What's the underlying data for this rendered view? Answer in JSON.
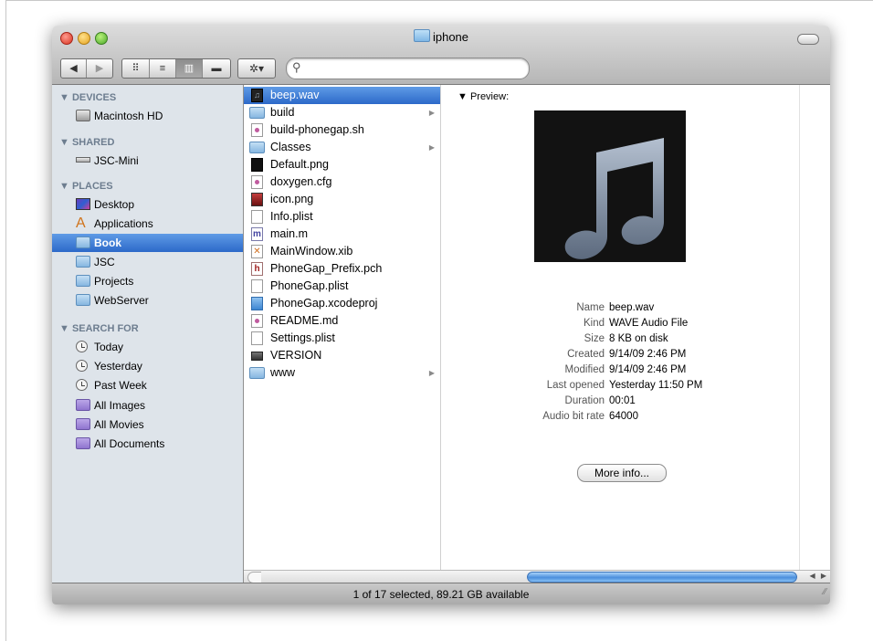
{
  "window": {
    "title": "iphone"
  },
  "toolbar": {
    "back_glyph": "◀",
    "forward_glyph": "▶",
    "views": [
      "⠿",
      "≡",
      "▥",
      "▬"
    ],
    "action_glyph": "✲▾",
    "search": {
      "placeholder": "",
      "value": ""
    }
  },
  "sidebar": {
    "sections": [
      {
        "label": "▼ DEVICES",
        "items": [
          {
            "label": "Macintosh HD",
            "icon": "hard-drive-icon"
          }
        ]
      },
      {
        "label": "▼ SHARED",
        "items": [
          {
            "label": "JSC-Mini",
            "icon": "mac-mini-icon"
          }
        ]
      },
      {
        "label": "▼ PLACES",
        "items": [
          {
            "label": "Desktop",
            "icon": "desktop-icon"
          },
          {
            "label": "Applications",
            "icon": "applications-icon"
          },
          {
            "label": "Book",
            "icon": "folder-icon",
            "selected": true
          },
          {
            "label": "JSC",
            "icon": "folder-icon"
          },
          {
            "label": "Projects",
            "icon": "folder-icon"
          },
          {
            "label": "WebServer",
            "icon": "folder-icon"
          }
        ]
      },
      {
        "label": "▼ SEARCH FOR",
        "items": [
          {
            "label": "Today",
            "icon": "clock-icon"
          },
          {
            "label": "Yesterday",
            "icon": "clock-icon"
          },
          {
            "label": "Past Week",
            "icon": "clock-icon"
          },
          {
            "label": "All Images",
            "icon": "smart-folder-icon"
          },
          {
            "label": "All Movies",
            "icon": "smart-folder-icon"
          },
          {
            "label": "All Documents",
            "icon": "smart-folder-icon"
          }
        ]
      }
    ]
  },
  "files": [
    {
      "name": "beep.wav",
      "icon": "audio-file-icon",
      "selected": true
    },
    {
      "name": "build",
      "icon": "folder-icon",
      "folder": true
    },
    {
      "name": "build-phonegap.sh",
      "icon": "script-file-icon"
    },
    {
      "name": "Classes",
      "icon": "folder-icon",
      "folder": true
    },
    {
      "name": "Default.png",
      "icon": "image-file-icon"
    },
    {
      "name": "doxygen.cfg",
      "icon": "script-file-icon"
    },
    {
      "name": "icon.png",
      "icon": "image-file-icon"
    },
    {
      "name": "Info.plist",
      "icon": "document-icon"
    },
    {
      "name": "main.m",
      "icon": "objc-source-icon"
    },
    {
      "name": "MainWindow.xib",
      "icon": "xib-file-icon"
    },
    {
      "name": "PhoneGap_Prefix.pch",
      "icon": "header-file-icon"
    },
    {
      "name": "PhoneGap.plist",
      "icon": "document-icon"
    },
    {
      "name": "PhoneGap.xcodeproj",
      "icon": "xcode-project-icon"
    },
    {
      "name": "README.md",
      "icon": "script-file-icon"
    },
    {
      "name": "Settings.plist",
      "icon": "document-icon"
    },
    {
      "name": "VERSION",
      "icon": "executable-icon"
    },
    {
      "name": "www",
      "icon": "folder-icon",
      "folder": true
    }
  ],
  "folder_arrow": "▶",
  "preview": {
    "heading": "▼ Preview:",
    "info": [
      {
        "key": "Name",
        "value": "beep.wav"
      },
      {
        "key": "Kind",
        "value": "WAVE Audio File"
      },
      {
        "key": "Size",
        "value": "8 KB on disk"
      },
      {
        "key": "Created",
        "value": "9/14/09 2:46 PM"
      },
      {
        "key": "Modified",
        "value": "9/14/09 2:46 PM"
      },
      {
        "key": "Last opened",
        "value": "Yesterday 11:50 PM"
      },
      {
        "key": "Duration",
        "value": "00:01"
      },
      {
        "key": "Audio bit rate",
        "value": "64000"
      }
    ],
    "more_info": "More info..."
  },
  "status": {
    "text": "1 of 17 selected, 89.21 GB available"
  },
  "grip_glyph": "II",
  "scroll_arrows": "◀ ▶",
  "resize_glyph": "⁄⁄"
}
